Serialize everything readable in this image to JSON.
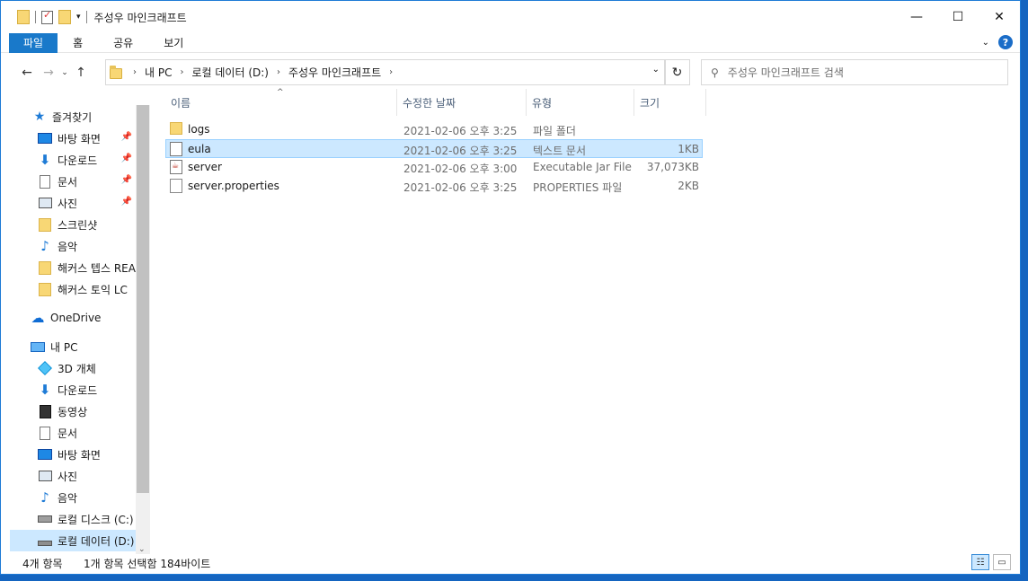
{
  "window": {
    "title": "주성우 마인크래프트",
    "controls": {
      "minimize": "—",
      "maximize": "☐",
      "close": "✕"
    }
  },
  "ribbon": {
    "tabs": [
      "파일",
      "홈",
      "공유",
      "보기"
    ]
  },
  "address": {
    "crumbs": [
      "내 PC",
      "로컬 데이터 (D:)",
      "주성우 마인크래프트"
    ],
    "search_placeholder": "주성우 마인크래프트 검색"
  },
  "nav": {
    "items": [
      {
        "label": "즐겨찾기",
        "icon": "star-icon",
        "pinned": false
      },
      {
        "label": "바탕 화면",
        "icon": "desktop-icon",
        "pinned": true
      },
      {
        "label": "다운로드",
        "icon": "download-icon",
        "pinned": true
      },
      {
        "label": "문서",
        "icon": "document-icon",
        "pinned": true
      },
      {
        "label": "사진",
        "icon": "pictures-icon",
        "pinned": true
      },
      {
        "label": "스크린샷",
        "icon": "folder-icon",
        "pinned": false
      },
      {
        "label": "음악",
        "icon": "music-icon",
        "pinned": false
      },
      {
        "label": "해커스 텝스 REA",
        "icon": "folder-icon",
        "pinned": false
      },
      {
        "label": "해커스 토익 LC",
        "icon": "folder-icon",
        "pinned": false
      },
      {
        "label": "OneDrive",
        "icon": "onedrive-icon",
        "pinned": false
      },
      {
        "label": "내 PC",
        "icon": "computer-icon",
        "pinned": false
      },
      {
        "label": "3D 개체",
        "icon": "3d-objects-icon",
        "pinned": false
      },
      {
        "label": "다운로드",
        "icon": "download-icon",
        "pinned": false
      },
      {
        "label": "동영상",
        "icon": "video-icon",
        "pinned": false
      },
      {
        "label": "문서",
        "icon": "document-icon",
        "pinned": false
      },
      {
        "label": "바탕 화면",
        "icon": "desktop-icon",
        "pinned": false
      },
      {
        "label": "사진",
        "icon": "pictures-icon",
        "pinned": false
      },
      {
        "label": "음악",
        "icon": "music-icon",
        "pinned": false
      },
      {
        "label": "로컬 디스크 (C:)",
        "icon": "drive-c-icon",
        "pinned": false
      },
      {
        "label": "로컬 데이터 (D:)",
        "icon": "drive-d-icon",
        "pinned": false,
        "selected": true
      }
    ]
  },
  "files": {
    "columns": [
      "이름",
      "수정한 날짜",
      "유형",
      "크기"
    ],
    "rows": [
      {
        "name": "logs",
        "date": "2021-02-06 오후 3:25",
        "type": "파일 폴더",
        "size": "",
        "icon": "folder-icon"
      },
      {
        "name": "eula",
        "date": "2021-02-06 오후 3:25",
        "type": "텍스트 문서",
        "size": "1KB",
        "icon": "text-file-icon",
        "selected": true
      },
      {
        "name": "server",
        "date": "2021-02-06 오후 3:00",
        "type": "Executable Jar File",
        "size": "37,073KB",
        "icon": "jar-file-icon"
      },
      {
        "name": "server.properties",
        "date": "2021-02-06 오후 3:25",
        "type": "PROPERTIES 파일",
        "size": "2KB",
        "icon": "properties-file-icon"
      }
    ]
  },
  "status": {
    "item_count": "4개 항목",
    "selection": "1개 항목 선택함 184바이트"
  }
}
